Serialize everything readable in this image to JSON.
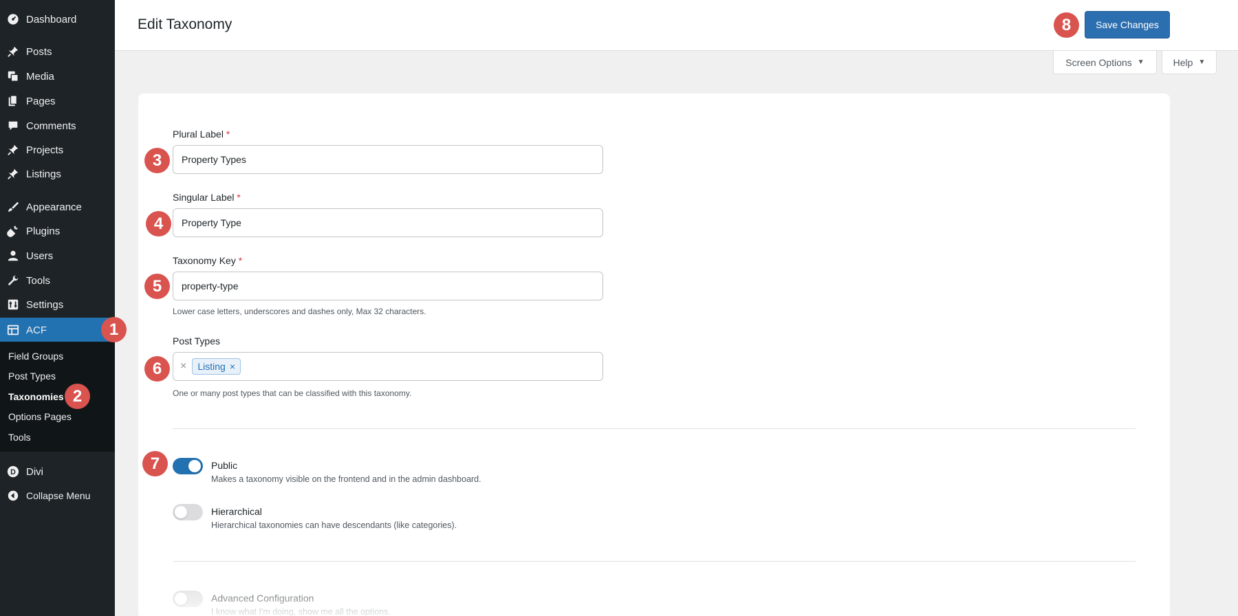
{
  "sidebar": {
    "items": [
      {
        "label": "Dashboard",
        "icon": "dashboard-icon"
      },
      {
        "label": "Posts",
        "icon": "pin-icon"
      },
      {
        "label": "Media",
        "icon": "media-icon"
      },
      {
        "label": "Pages",
        "icon": "pages-icon"
      },
      {
        "label": "Comments",
        "icon": "comment-icon"
      },
      {
        "label": "Projects",
        "icon": "pin-icon"
      },
      {
        "label": "Listings",
        "icon": "pin-icon"
      },
      {
        "label": "Appearance",
        "icon": "brush-icon"
      },
      {
        "label": "Plugins",
        "icon": "plug-icon"
      },
      {
        "label": "Users",
        "icon": "user-icon"
      },
      {
        "label": "Tools",
        "icon": "wrench-icon"
      },
      {
        "label": "Settings",
        "icon": "settings-icon"
      },
      {
        "label": "ACF",
        "icon": "acf-icon"
      },
      {
        "label": "Divi",
        "icon": "divi-icon"
      },
      {
        "label": "Collapse Menu",
        "icon": "collapse-icon"
      }
    ],
    "submenu": [
      "Field Groups",
      "Post Types",
      "Taxonomies",
      "Options Pages",
      "Tools"
    ]
  },
  "markers": [
    "1",
    "2",
    "3",
    "4",
    "5",
    "6",
    "7",
    "8"
  ],
  "header": {
    "title": "Edit Taxonomy",
    "save_label": "Save Changes",
    "screen_options": "Screen Options",
    "help": "Help"
  },
  "form": {
    "plural_label": "Plural Label",
    "plural_value": "Property Types",
    "singular_label": "Singular Label",
    "singular_value": "Property Type",
    "key_label": "Taxonomy Key",
    "key_value": "property-type",
    "key_help": "Lower case letters, underscores and dashes only, Max 32 characters.",
    "post_types_label": "Post Types",
    "post_types_selected": "Listing",
    "post_types_help": "One or many post types that can be classified with this taxonomy.",
    "required_mark": "*"
  },
  "toggles": [
    {
      "title": "Public",
      "desc": "Makes a taxonomy visible on the frontend and in the admin dashboard.",
      "on": true
    },
    {
      "title": "Hierarchical",
      "desc": "Hierarchical taxonomies can have descendants (like categories).",
      "on": false
    },
    {
      "title": "Advanced Configuration",
      "desc": "I know what I'm doing, show me all the options.",
      "on": false
    }
  ],
  "colors": {
    "sidebar_bg": "#1d2327",
    "accent": "#2271b1",
    "marker": "#d9534f",
    "required": "#d63638"
  }
}
